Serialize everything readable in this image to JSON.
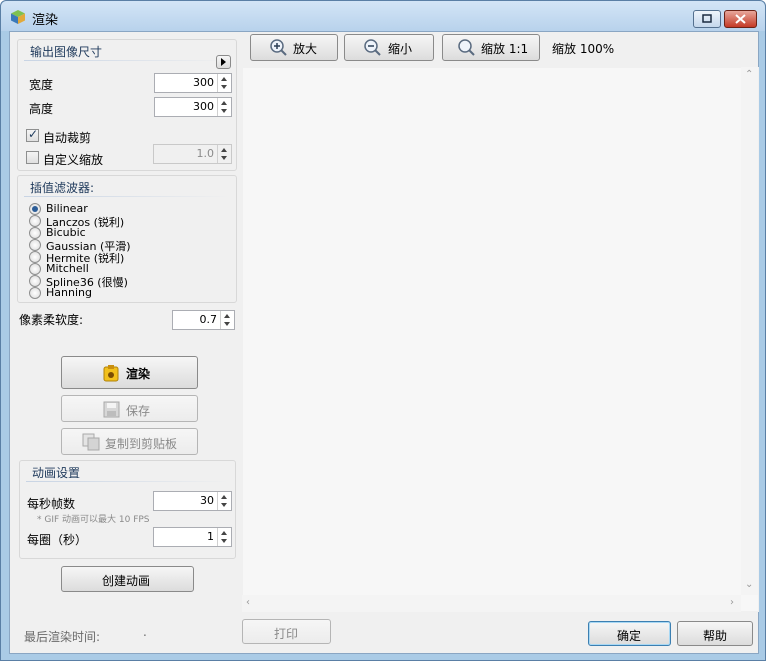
{
  "window": {
    "title": "渲染",
    "icon": "cube-icon"
  },
  "output_size": {
    "title": "输出图像尺寸",
    "width_label": "宽度",
    "width_value": "300",
    "height_label": "高度",
    "height_value": "300",
    "auto_crop_label": "自动裁剪",
    "auto_crop_checked": true,
    "custom_scale_label": "自定义缩放",
    "custom_scale_checked": false,
    "custom_scale_value": "1.0"
  },
  "filter": {
    "title": "插值滤波器:",
    "options": [
      "Bilinear",
      "Lanczos (锐利)",
      "Bicubic",
      "Gaussian (平滑)",
      "Hermite (锐利)",
      "Mitchell",
      "Spline36 (很慢)",
      "Hanning"
    ],
    "selected": "Bilinear"
  },
  "softness": {
    "label": "像素柔软度:",
    "value": "0.7"
  },
  "actions": {
    "render": "渲染",
    "save": "保存",
    "copy": "复制到剪贴板"
  },
  "animation": {
    "title": "动画设置",
    "fps_label": "每秒帧数",
    "fps_value": "30",
    "fps_hint": "* GIF 动画可以最大 10 FPS",
    "loop_label": "每圈（秒）",
    "loop_value": "1",
    "create_button": "创建动画"
  },
  "toolbar": {
    "zoom_in": "放大",
    "zoom_out": "缩小",
    "zoom_reset": "缩放 1:1",
    "zoom_status": "缩放 100%"
  },
  "footer": {
    "last_render_label": "最后渲染时间:",
    "last_render_value": ".",
    "print": "打印",
    "ok": "确定",
    "help": "帮助"
  },
  "colors": {
    "title_bar": "#b8d2ec",
    "accent": "#2c5d97",
    "panel": "#f0f0f0"
  }
}
